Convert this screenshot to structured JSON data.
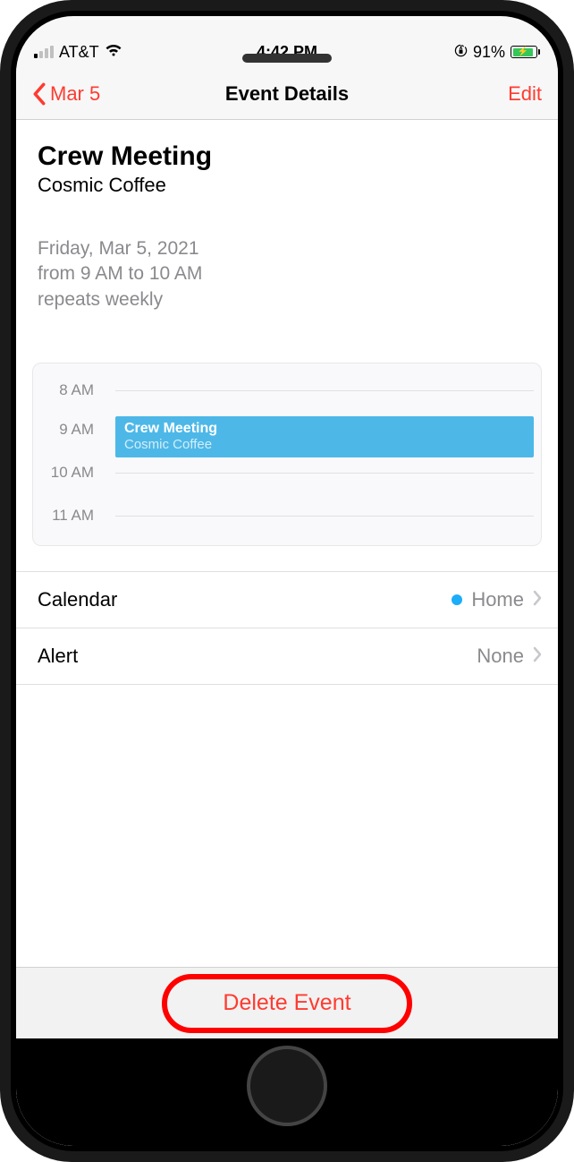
{
  "status": {
    "carrier": "AT&T",
    "time": "4:42 PM",
    "battery_percent": "91%"
  },
  "nav": {
    "back_label": "Mar 5",
    "title": "Event Details",
    "edit_label": "Edit"
  },
  "event": {
    "title": "Crew Meeting",
    "location": "Cosmic Coffee",
    "date_line": "Friday, Mar 5, 2021",
    "time_line": "from 9 AM to 10 AM",
    "repeat_line": "repeats weekly"
  },
  "timeline": {
    "hours": [
      "8 AM",
      "9 AM",
      "10 AM",
      "11 AM"
    ],
    "block_title": "Crew Meeting",
    "block_sub": "Cosmic Coffee"
  },
  "settings": {
    "calendar_label": "Calendar",
    "calendar_value": "Home",
    "alert_label": "Alert",
    "alert_value": "None"
  },
  "delete_label": "Delete Event"
}
